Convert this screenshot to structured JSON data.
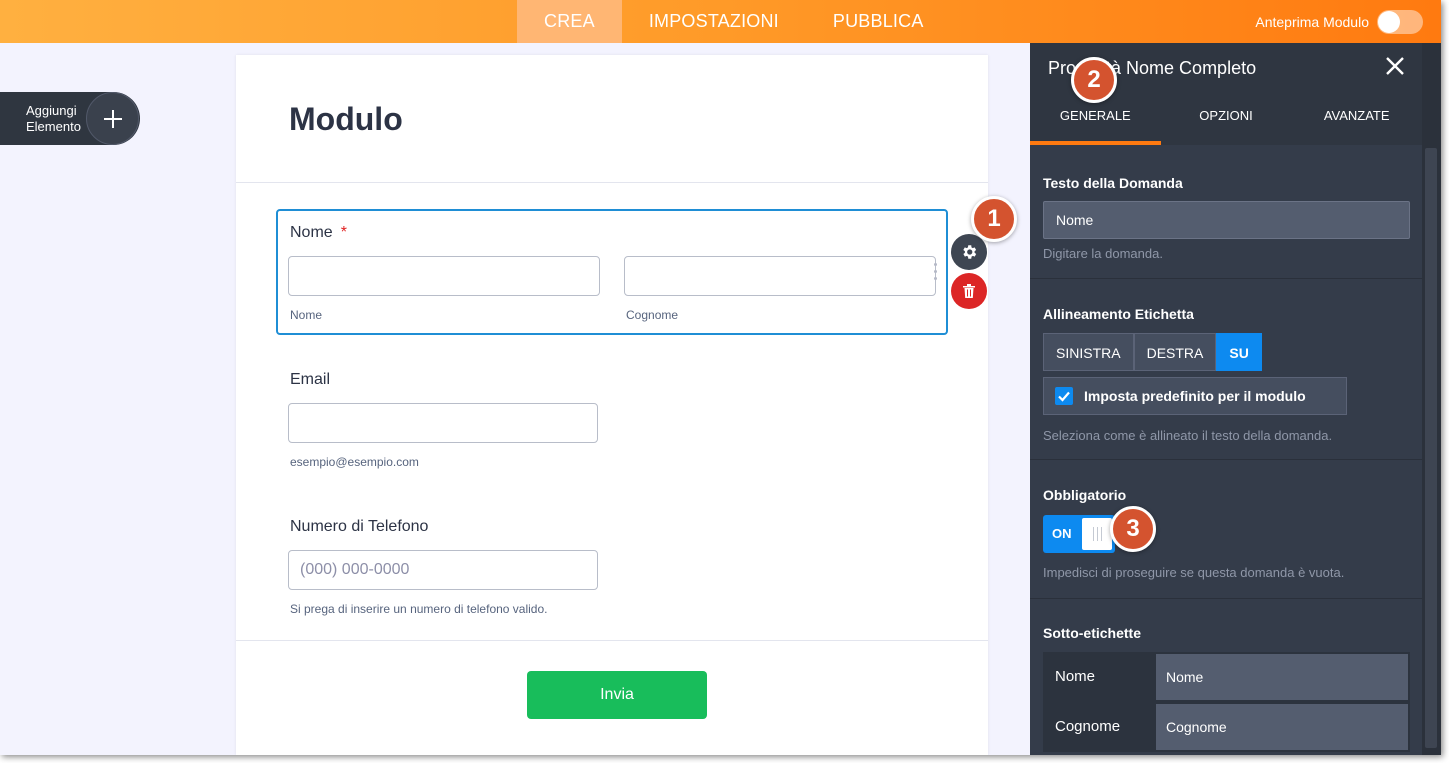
{
  "topnav": {
    "items": [
      {
        "label": "CREA",
        "active": true
      },
      {
        "label": "IMPOSTAZIONI",
        "active": false
      },
      {
        "label": "PUBBLICA",
        "active": false
      }
    ],
    "preview_label": "Anteprima Modulo",
    "preview_on": false
  },
  "add_element": {
    "label_line1": "Aggiungi",
    "label_line2": "Elemento",
    "icon": "plus-icon"
  },
  "form": {
    "title": "Modulo",
    "fields": {
      "name": {
        "label": "Nome",
        "required_mark": "*",
        "first_sublabel": "Nome",
        "last_sublabel": "Cognome"
      },
      "email": {
        "label": "Email",
        "sublabel": "esempio@esempio.com"
      },
      "phone": {
        "label": "Numero di Telefono",
        "placeholder": "(000) 000-0000",
        "sublabel": "Si prega di inserire un numero di telefono valido."
      }
    },
    "submit_label": "Invia"
  },
  "badges": [
    "1",
    "2",
    "3"
  ],
  "panel": {
    "title": "Proprietà Nome Completo",
    "tabs": [
      {
        "label": "GENERALE",
        "active": true
      },
      {
        "label": "OPZIONI",
        "active": false
      },
      {
        "label": "AVANZATE",
        "active": false
      }
    ],
    "question_text": {
      "title": "Testo della Domanda",
      "value": "Nome",
      "help": "Digitare la domanda."
    },
    "label_alignment": {
      "title": "Allineamento Etichetta",
      "options": [
        "SINISTRA",
        "DESTRA",
        "SU"
      ],
      "selected": "SU",
      "default_checkbox": "Imposta predefinito per il modulo",
      "help": "Seleziona come è allineato il testo della domanda."
    },
    "required": {
      "title": "Obbligatorio",
      "toggle_label": "ON",
      "help": "Impedisci di proseguire se questa domanda è vuota."
    },
    "sublabels": {
      "title": "Sotto-etichette",
      "rows": [
        {
          "key": "Nome",
          "value": "Nome"
        },
        {
          "key": "Cognome",
          "value": "Cognome"
        }
      ]
    }
  },
  "colors": {
    "accent": "#ff7a10",
    "primary_blue": "#0d8af0",
    "submit_green": "#18bd5b",
    "badge": "#d4532f",
    "panel_bg": "#343c4a"
  }
}
